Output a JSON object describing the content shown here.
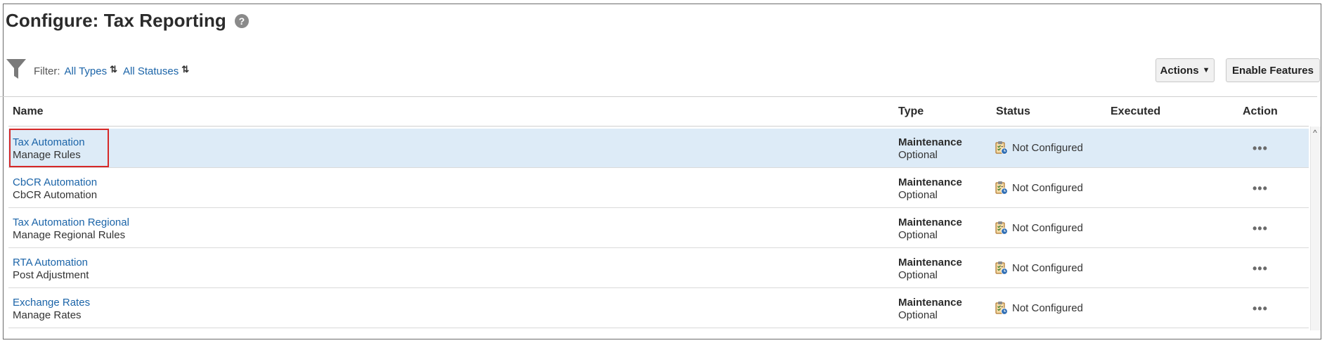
{
  "page": {
    "title": "Configure: Tax Reporting",
    "help_glyph": "?"
  },
  "filter": {
    "label": "Filter:",
    "types": "All Types",
    "statuses": "All Statuses",
    "swap_glyph": "⇅"
  },
  "toolbar": {
    "actions_label": "Actions",
    "enable_label": "Enable Features"
  },
  "table": {
    "columns": {
      "name": "Name",
      "type": "Type",
      "status": "Status",
      "executed": "Executed",
      "action": "Action"
    },
    "rows": [
      {
        "name": "Tax Automation",
        "sub": "Manage Rules",
        "type": "Maintenance",
        "type_sub": "Optional",
        "status": "Not Configured",
        "executed": "",
        "action": "•••"
      },
      {
        "name": "CbCR Automation",
        "sub": "CbCR Automation",
        "type": "Maintenance",
        "type_sub": "Optional",
        "status": "Not Configured",
        "executed": "",
        "action": "•••"
      },
      {
        "name": "Tax Automation Regional",
        "sub": "Manage Regional Rules",
        "type": "Maintenance",
        "type_sub": "Optional",
        "status": "Not Configured",
        "executed": "",
        "action": "•••"
      },
      {
        "name": "RTA Automation",
        "sub": "Post Adjustment",
        "type": "Maintenance",
        "type_sub": "Optional",
        "status": "Not Configured",
        "executed": "",
        "action": "•••"
      },
      {
        "name": "Exchange Rates",
        "sub": "Manage Rates",
        "type": "Maintenance",
        "type_sub": "Optional",
        "status": "Not Configured",
        "executed": "",
        "action": "•••"
      }
    ]
  },
  "colors": {
    "link": "#1b64a8",
    "selected_row": "#ddebf7",
    "highlight": "#d62828"
  },
  "icons": {
    "help": "help-icon",
    "filter": "funnel-icon",
    "swap": "swap-icon",
    "status": "clipboard-clock-icon",
    "action": "more-horizontal-icon"
  }
}
